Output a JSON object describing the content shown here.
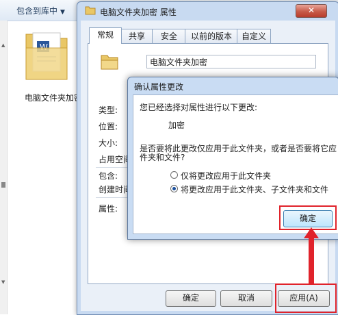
{
  "explorer": {
    "library_button": "包含到库中",
    "folder_name": "电脑文件夹加密"
  },
  "properties_dialog": {
    "title": "电脑文件夹加密 属性",
    "close_symbol": "✕",
    "tabs": [
      "常规",
      "共享",
      "安全",
      "以前的版本",
      "自定义"
    ],
    "folder_name_value": "电脑文件夹加密",
    "labels": {
      "type": "类型:",
      "location": "位置:",
      "size": "大小:",
      "size_on_disk": "占用空间",
      "contains": "包含:",
      "created": "创建时间",
      "attributes": "属性:"
    },
    "buttons": {
      "ok": "确定",
      "cancel": "取消",
      "apply": "应用(A)"
    }
  },
  "confirm_dialog": {
    "title": "确认属性更改",
    "intro": "您已经选择对属性进行以下更改:",
    "change": "加密",
    "question_line1": "是否要将此更改仅应用于此文件夹，或者是否要将它应",
    "question_line2": "件夹和文件?",
    "options": [
      {
        "label": "仅将更改应用于此文件夹",
        "selected": false
      },
      {
        "label": "将更改应用于此文件夹、子文件夹和文件",
        "selected": true
      }
    ],
    "ok_button": "确定"
  },
  "annotation_color": "#e0232b"
}
